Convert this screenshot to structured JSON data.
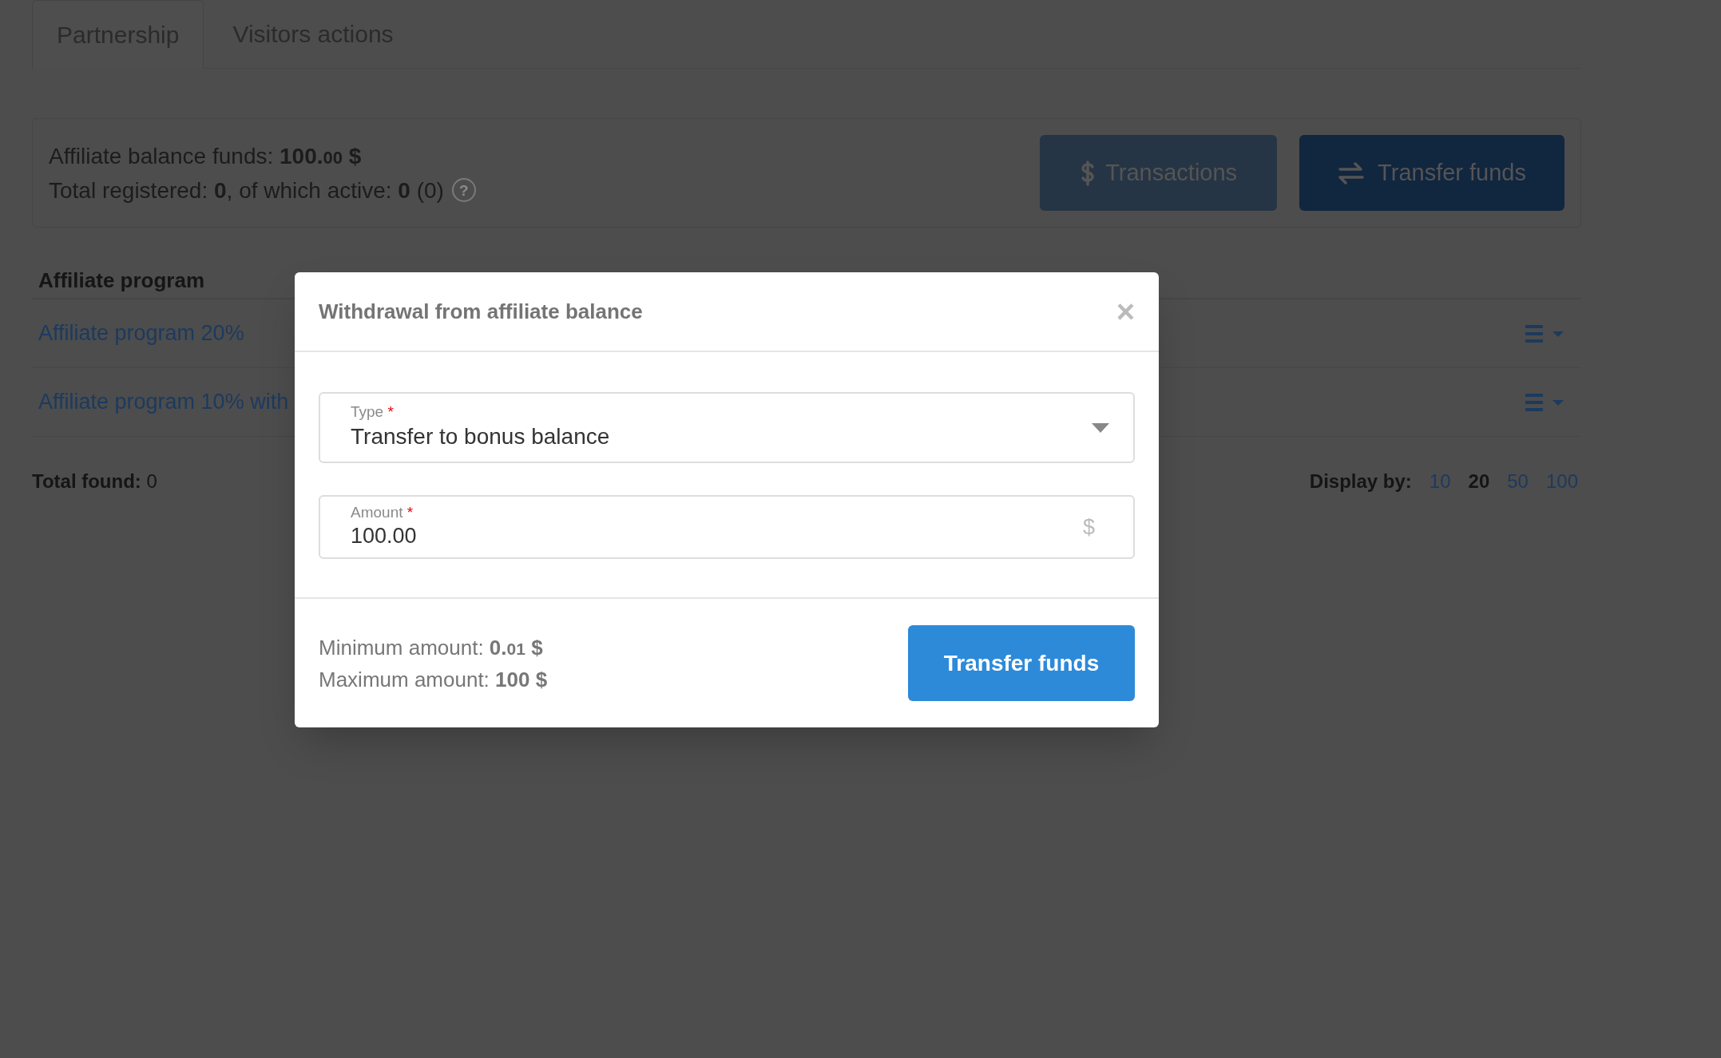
{
  "tabs": [
    {
      "label": "Partnership",
      "selected": true
    },
    {
      "label": "Visitors actions",
      "selected": false
    }
  ],
  "summary": {
    "balance_label": "Affiliate balance funds:",
    "balance_amount": "100.",
    "balance_cents": "00",
    "balance_currency": "$",
    "registered": "Total registered: **0**, of which active: **0** (0)",
    "help": "?"
  },
  "actions": [
    {
      "label": "Transactions",
      "kind": "dollar",
      "disabled": true
    },
    {
      "label": "Transfer funds",
      "kind": "transfer",
      "disabled": false
    }
  ],
  "table": {
    "columns": [
      "Affiliate program"
    ],
    "rows": [
      {
        "name": "Affiliate program 20%"
      },
      {
        "name": "Affiliate program 10% with"
      }
    ]
  },
  "total_found": {
    "label": "Total found:",
    "value": "0"
  },
  "display_by": {
    "label": "Display by:",
    "options": [
      {
        "label": "10",
        "selected": false
      },
      {
        "label": "20",
        "selected": true
      },
      {
        "label": "50",
        "selected": false
      },
      {
        "label": "100",
        "selected": false
      }
    ]
  },
  "modal": {
    "title": "Withdrawal from affiliate balance",
    "close": "×",
    "type_field": {
      "label": "Type",
      "required": "*",
      "value": "Transfer to bonus balance"
    },
    "amount_field": {
      "label": "Amount",
      "required": "*",
      "value": "100.00",
      "suffix": "$"
    },
    "minimum": {
      "label": "Minimum amount:",
      "amount": "0.",
      "cents": "01",
      "currency": "$"
    },
    "maximum": {
      "label": "Maximum amount:",
      "amount": "100",
      "currency": "$"
    },
    "submit": "Transfer funds"
  }
}
